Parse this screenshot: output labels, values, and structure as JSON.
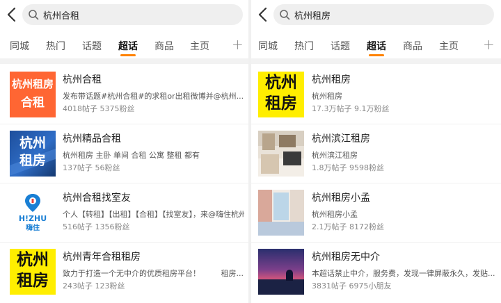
{
  "left": {
    "search": {
      "query": "杭州合租"
    },
    "tabs": [
      {
        "label": "同城"
      },
      {
        "label": "热门"
      },
      {
        "label": "话题"
      },
      {
        "label": "超话",
        "active": true
      },
      {
        "label": "商品"
      },
      {
        "label": "主页"
      }
    ],
    "plus_label": "+",
    "results": [
      {
        "title": "杭州合租",
        "desc": "发布带话题#杭州合租#的求租or出租微博并@杭州...",
        "stats": "4018帖子 5375粉丝",
        "logo": {
          "line1": "杭州租房",
          "line2": "合租",
          "bg": "#ff6633",
          "fg": "#ffffff"
        }
      },
      {
        "title": "杭州精品合租",
        "desc": "杭州租房 主卧 单间 合租 公寓 整租 都有",
        "stats": "137帖子 56粉丝",
        "logo": {
          "line1": "杭州",
          "line2": "租房",
          "bg": "#1e4f9c",
          "fg": "#ffffff"
        }
      },
      {
        "title": "杭州合租找室友",
        "desc": "个人【转租】【出租】【合租】【找室友】，来@嗨住杭州租...",
        "stats": "516帖子 1356粉丝",
        "logo": {
          "brand": "H!ZHU",
          "brand_cn": "嗨住",
          "bg": "#ffffff",
          "fg": "#1a7fd4"
        }
      },
      {
        "title": "杭州青年合租租房",
        "desc": "致力于打造一个无中介的优质租房平台！",
        "desc_tail": "租房...",
        "stats": "243帖子 123粉丝",
        "logo": {
          "line1": "杭州",
          "line2": "租房",
          "bg": "#ffee00",
          "fg": "#111111"
        }
      }
    ]
  },
  "right": {
    "search": {
      "query": "杭州租房"
    },
    "tabs": [
      {
        "label": "同城"
      },
      {
        "label": "热门"
      },
      {
        "label": "话题"
      },
      {
        "label": "超话",
        "active": true
      },
      {
        "label": "商品"
      },
      {
        "label": "主页"
      }
    ],
    "plus_label": "+",
    "results": [
      {
        "title": "杭州租房",
        "desc": "杭州租房",
        "stats": "17.3万帖子 9.1万粉丝",
        "logo": {
          "line1": "杭州",
          "line2": "租房",
          "bg": "#ffee00",
          "fg": "#111111"
        }
      },
      {
        "title": "杭州滨江租房",
        "desc": "杭州滨江租房",
        "stats": "1.8万帖子 9598粉丝",
        "photo": "room-interior"
      },
      {
        "title": "杭州租房小孟",
        "desc": "杭州租房小孟",
        "stats": "2.1万帖子 8172粉丝",
        "photo": "bedroom-window"
      },
      {
        "title": "杭州租房无中介",
        "desc": "本超话禁止中介，服务费，发现一律屏蔽永久，发贴...",
        "stats": "3831帖子 6975小朋友",
        "photo": "sunset-silhouette"
      }
    ]
  },
  "colors": {
    "accent": "#ff8200",
    "search_bg": "#efefef",
    "divider": "#f2f2f2"
  },
  "icons": {
    "back": "chevron-left-icon",
    "search": "search-icon",
    "add": "plus-icon"
  }
}
